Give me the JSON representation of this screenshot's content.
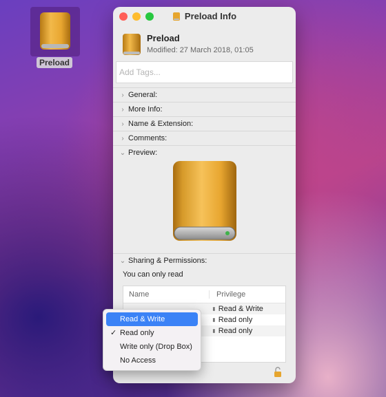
{
  "desktop": {
    "label": "Preload",
    "icon": "external-drive-icon"
  },
  "window": {
    "title": "Preload",
    "title_suffix": "Info",
    "file_name": "Preload",
    "modified": "Modified: 27 March 2018, 01:05",
    "tags_placeholder": "Add Tags..."
  },
  "sections": [
    {
      "label": "General:",
      "expanded": false
    },
    {
      "label": "More Info:",
      "expanded": false
    },
    {
      "label": "Name & Extension:",
      "expanded": false
    },
    {
      "label": "Comments:",
      "expanded": false
    },
    {
      "label": "Preview:",
      "expanded": true
    }
  ],
  "sharing": {
    "label": "Sharing & Permissions:",
    "note": "You can only read",
    "columns": {
      "name": "Name",
      "privilege": "Privilege"
    },
    "rows": [
      {
        "name": "...",
        "privilege": "Read & Write"
      },
      {
        "name": "",
        "privilege": "Read only"
      },
      {
        "name": "",
        "privilege": "Read only"
      }
    ]
  },
  "menu": {
    "items": [
      {
        "label": "Read & Write",
        "highlighted": true,
        "checked": false
      },
      {
        "label": "Read only",
        "highlighted": false,
        "checked": true
      },
      {
        "label": "Write only (Drop Box)",
        "highlighted": false,
        "checked": false
      },
      {
        "label": "No Access",
        "highlighted": false,
        "checked": false
      }
    ],
    "check_glyph": "✓"
  },
  "colors": {
    "drive": "#e6a52e",
    "highlight": "#3b82f6"
  }
}
